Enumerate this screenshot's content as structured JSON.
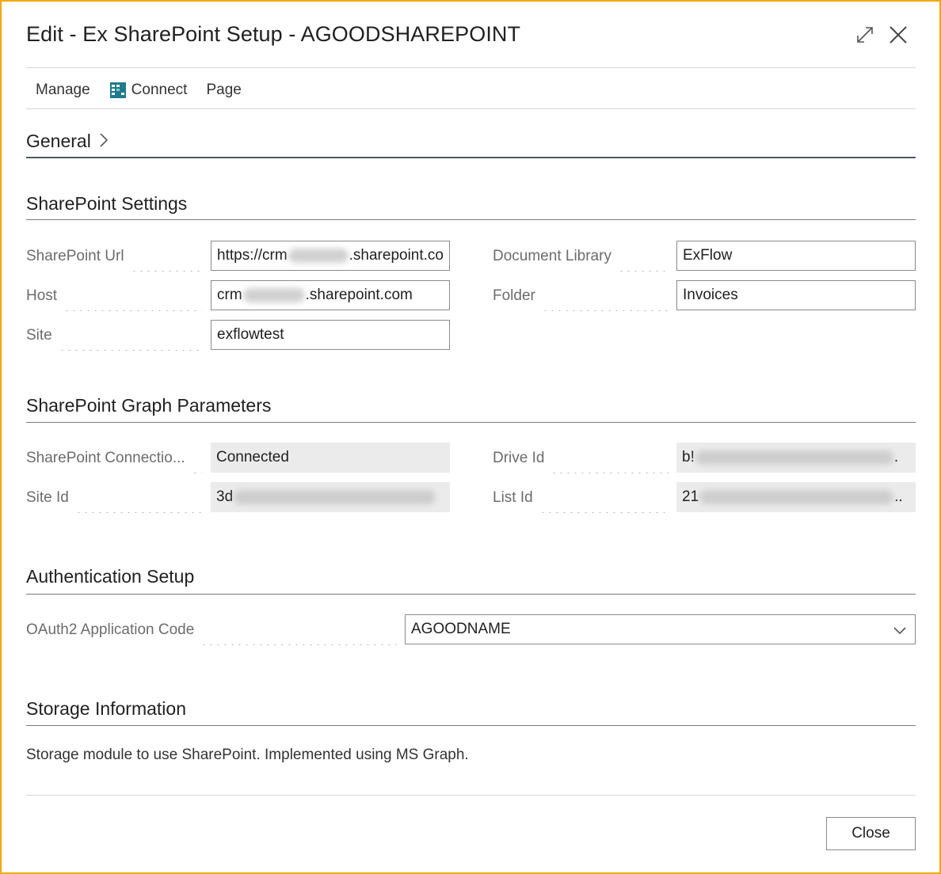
{
  "dialog": {
    "title": "Edit - Ex SharePoint Setup - AGOODSHAREPOINT",
    "border_color": "#f2a900"
  },
  "actions": [
    {
      "label": "Manage",
      "icon": ""
    },
    {
      "label": "Connect",
      "icon": "connect-icon"
    },
    {
      "label": "Page",
      "icon": ""
    }
  ],
  "general": {
    "title": "General"
  },
  "sharepoint_settings": {
    "title": "SharePoint Settings",
    "url": {
      "label": "SharePoint Url",
      "prefix": "https://crm",
      "suffix": ".sharepoint.co"
    },
    "host": {
      "label": "Host",
      "prefix": "crm",
      "suffix": ".sharepoint.com"
    },
    "site": {
      "label": "Site",
      "value": "exflowtest"
    },
    "document_library": {
      "label": "Document Library",
      "value": "ExFlow"
    },
    "folder": {
      "label": "Folder",
      "value": "Invoices"
    }
  },
  "graph_parameters": {
    "title": "SharePoint Graph Parameters",
    "connection": {
      "label": "SharePoint Connectio...",
      "value": "Connected"
    },
    "site_id": {
      "label": "Site Id",
      "prefix": "3d"
    },
    "drive_id": {
      "label": "Drive Id",
      "prefix": "b!",
      "suffix": "."
    },
    "list_id": {
      "label": "List Id",
      "prefix": "21",
      "suffix": ".."
    }
  },
  "authentication": {
    "title": "Authentication Setup",
    "oauth_code": {
      "label": "OAuth2 Application Code",
      "value": "AGOODNAME"
    }
  },
  "storage": {
    "title": "Storage Information",
    "description": "Storage module to use SharePoint. Implemented using MS Graph."
  },
  "footer": {
    "close_label": "Close"
  }
}
